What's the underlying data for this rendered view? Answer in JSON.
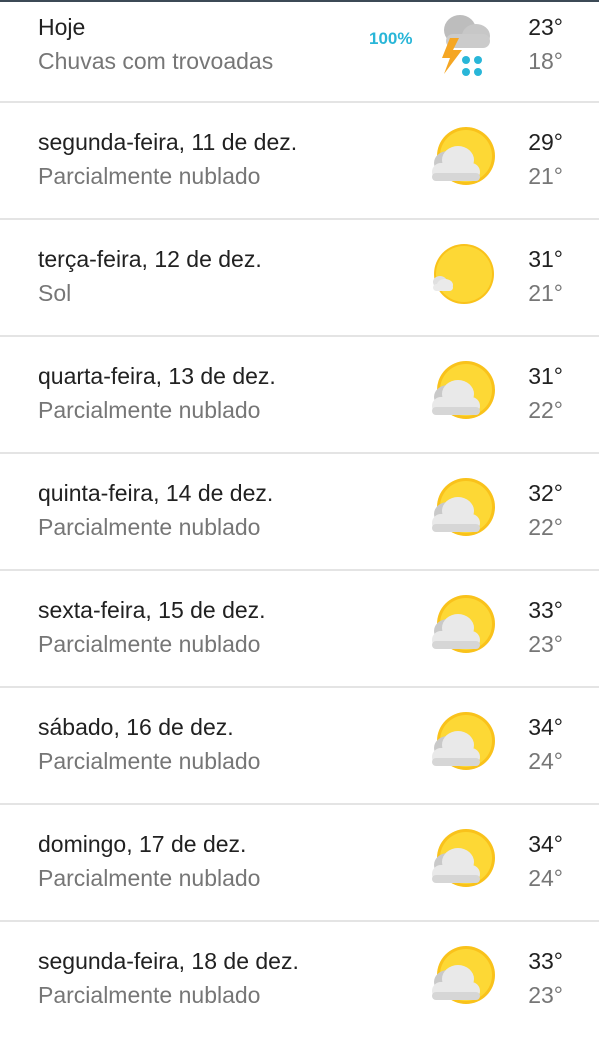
{
  "forecast": [
    {
      "day": "Hoje",
      "condition": "Chuvas com trovoadas",
      "high": "23°",
      "low": "18°",
      "precip": "100%",
      "icon": "thunderstorm-icon"
    },
    {
      "day": "segunda-feira, 11 de dez.",
      "condition": "Parcialmente nublado",
      "high": "29°",
      "low": "21°",
      "icon": "partly-cloudy-icon"
    },
    {
      "day": "terça-feira, 12 de dez.",
      "condition": "Sol",
      "high": "31°",
      "low": "21°",
      "icon": "sunny-icon"
    },
    {
      "day": "quarta-feira, 13 de dez.",
      "condition": "Parcialmente nublado",
      "high": "31°",
      "low": "22°",
      "icon": "partly-cloudy-icon"
    },
    {
      "day": "quinta-feira, 14 de dez.",
      "condition": "Parcialmente nublado",
      "high": "32°",
      "low": "22°",
      "icon": "partly-cloudy-icon"
    },
    {
      "day": "sexta-feira, 15 de dez.",
      "condition": "Parcialmente nublado",
      "high": "33°",
      "low": "23°",
      "icon": "partly-cloudy-icon"
    },
    {
      "day": "sábado, 16 de dez.",
      "condition": "Parcialmente nublado",
      "high": "34°",
      "low": "24°",
      "icon": "partly-cloudy-icon"
    },
    {
      "day": "domingo, 17 de dez.",
      "condition": "Parcialmente nublado",
      "high": "34°",
      "low": "24°",
      "icon": "partly-cloudy-icon"
    },
    {
      "day": "segunda-feira, 18 de dez.",
      "condition": "Parcialmente nublado",
      "high": "33°",
      "low": "23°",
      "icon": "partly-cloudy-icon"
    }
  ],
  "colors": {
    "sun": "#fdd835",
    "sun_edge": "#f9c21b",
    "cloud": "#e9e9e9",
    "cloud_shadow": "#c9c9c9",
    "rain": "#29b6d8",
    "bolt": "#f5a623"
  }
}
